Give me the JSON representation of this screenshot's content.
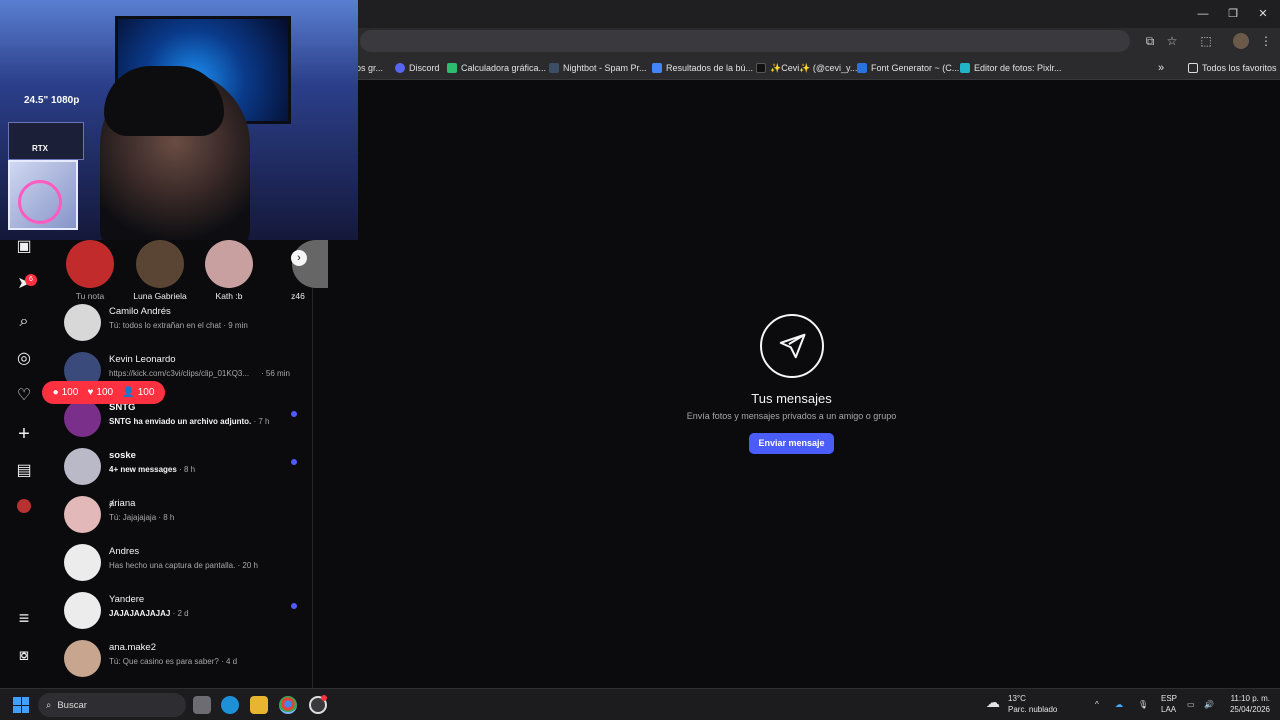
{
  "window": {
    "controls": [
      "—",
      "❐",
      "✕"
    ]
  },
  "bookmarks": {
    "items": [
      {
        "label": "os gr...",
        "color": "#8a8a8a"
      },
      {
        "label": "Discord",
        "color": "#5865f2"
      },
      {
        "label": "Calculadora gráfica...",
        "color": "#2dbd6e"
      },
      {
        "label": "Nightbot - Spam Pr...",
        "color": "#3b4e66"
      },
      {
        "label": "Resultados de la bú...",
        "color": "#4285f4"
      },
      {
        "label": "✨Cevi✨ (@cevi_y...",
        "color": "#111111"
      },
      {
        "label": "Font Generator ~ (C...",
        "color": "#2b6fe0"
      },
      {
        "label": "Editor de fotos: Pixlr...",
        "color": "#22b5c8"
      }
    ],
    "more": "»",
    "all_label": "Todos los favoritos"
  },
  "rail": {
    "notifications_badge": "6",
    "icons": [
      "reels-icon",
      "messages-icon",
      "search-icon",
      "explore-icon",
      "heart-icon",
      "create-icon",
      "dashboard-icon",
      "profile-icon",
      "menu-icon",
      "meta-icon"
    ]
  },
  "notes": [
    {
      "name": "Tu nota",
      "muted": true,
      "color": "#c22b2b"
    },
    {
      "name": "Luna Gabriela",
      "muted": false,
      "color": "#5a4535"
    },
    {
      "name": "Kath :b",
      "muted": false,
      "color": "#c9a0a0"
    },
    {
      "name": "z46",
      "muted": false,
      "color": "#666666"
    }
  ],
  "stats_pill": {
    "comments": "100",
    "likes": "100",
    "followers": "100"
  },
  "conversations": [
    {
      "name": "Camilo Andrés",
      "preview": "Tú: todos lo extrañan en el chat",
      "time": "· 9 min",
      "unread": false
    },
    {
      "name": "Kevin Leonardo",
      "preview": "https://kick.com/c3vi/clips/clip_01KQ3...",
      "time": "· 56 min",
      "unread": false
    },
    {
      "name": "SNTG",
      "preview": "SNTG ha enviado un archivo adjunto.",
      "time": "· 7 h",
      "unread": true
    },
    {
      "name": "soske",
      "preview": "4+ new messages",
      "time": "· 8 h",
      "unread": true
    },
    {
      "name": "ⱥriana",
      "preview": "Tú: Jajajajaja",
      "time": "· 8 h",
      "unread": false
    },
    {
      "name": "Andres",
      "preview": "Has hecho una captura de pantalla.",
      "time": "· 20 h",
      "unread": false
    },
    {
      "name": "Yandere",
      "preview": "JAJAJAAJAJAJ",
      "time": "· 2 d",
      "unread": true
    },
    {
      "name": "ana.make2",
      "preview": "Tú: Que casino es para saber?",
      "time": "· 4 d",
      "unread": false
    }
  ],
  "empty_state": {
    "title": "Tus mensajes",
    "subtitle": "Envía fotos y mensajes privados a un amigo o grupo",
    "button": "Enviar mensaje"
  },
  "webcam": {
    "monitor_label": "24.5\" 1080p",
    "gpu_label": "RTX"
  },
  "taskbar": {
    "search_placeholder": "Buscar",
    "weather_temp": "13°C",
    "weather_desc": "Parc. nublado",
    "lang": "ESP",
    "lang_sub": "LAA",
    "time": "11:10 p. m.",
    "date": "25/04/2026"
  }
}
